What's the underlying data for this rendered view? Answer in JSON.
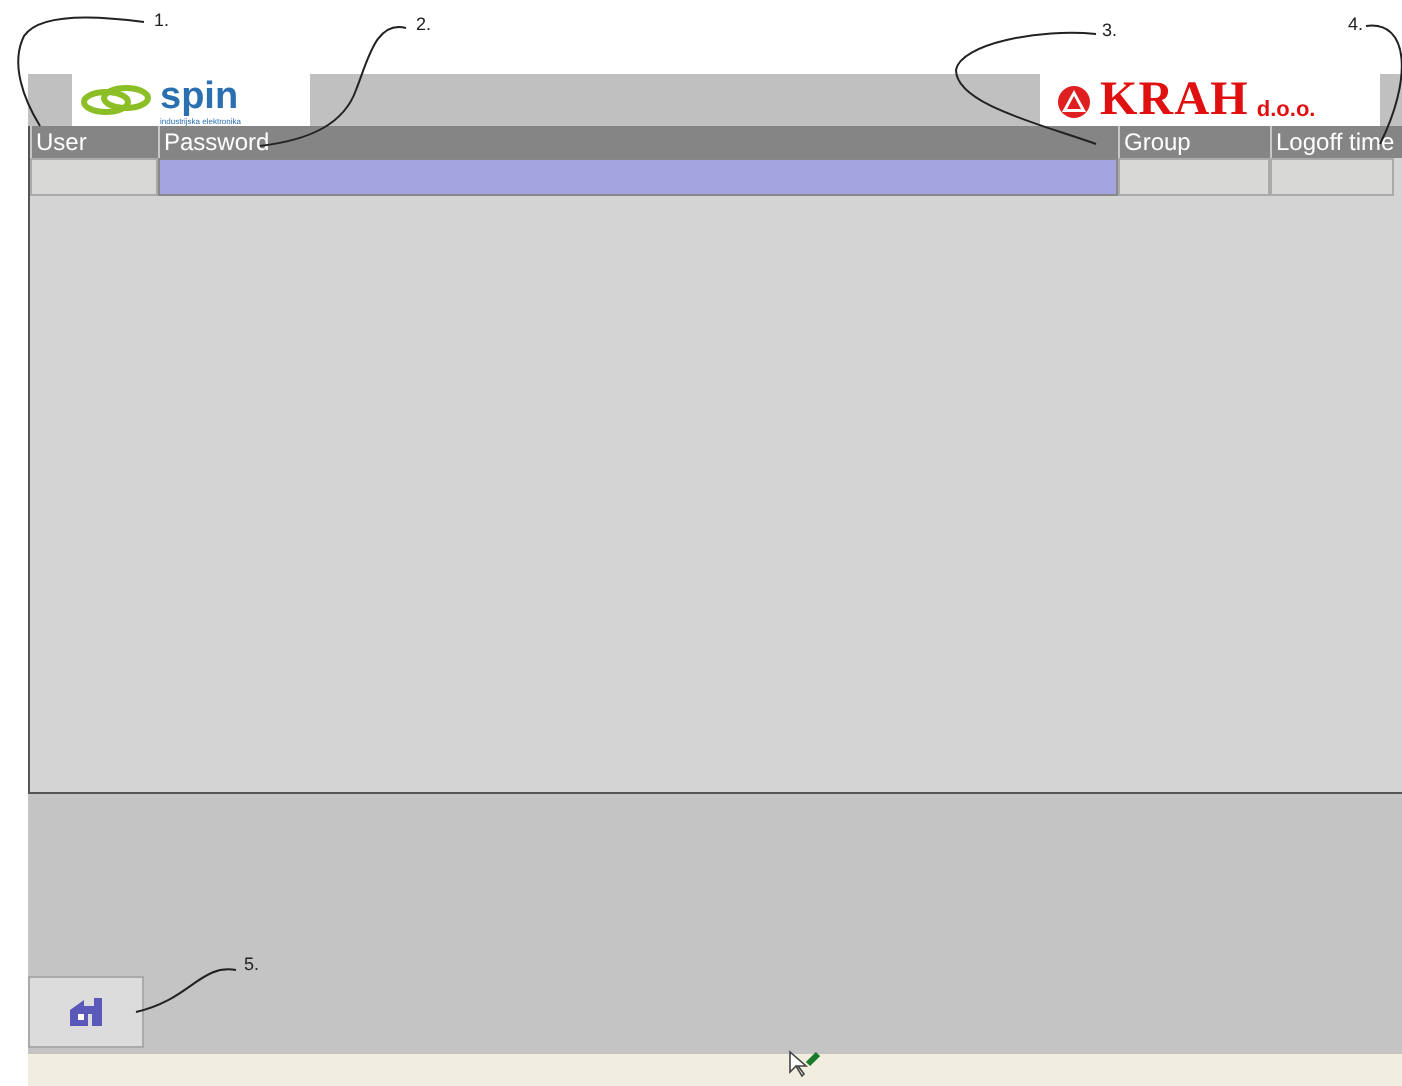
{
  "header": {
    "left_logo": {
      "name": "spin",
      "tagline": "industrijska elektronika"
    },
    "right_logo": {
      "name": "KRAH",
      "suffix": "d.o.o."
    }
  },
  "table": {
    "columns": [
      "User",
      "Password",
      "Group",
      "Logoff time"
    ],
    "rows": [
      {
        "cells": [
          {
            "selected": false
          },
          {
            "selected": true
          },
          {
            "selected": false
          },
          {
            "selected": false
          }
        ]
      }
    ]
  },
  "home_button": {
    "kind": "home"
  },
  "callouts": [
    {
      "label": "1."
    },
    {
      "label": "2."
    },
    {
      "label": "3."
    },
    {
      "label": "4."
    },
    {
      "label": "5."
    }
  ]
}
